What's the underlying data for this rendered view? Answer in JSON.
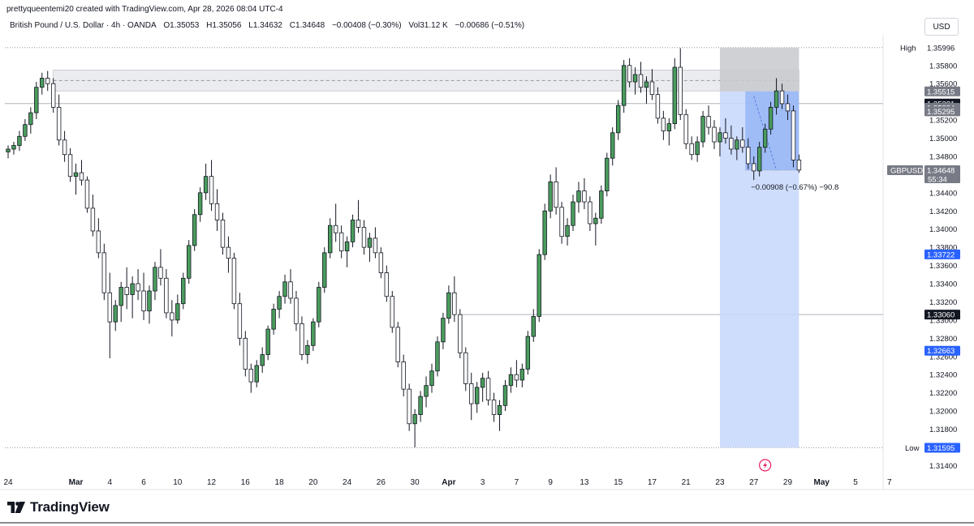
{
  "header": {
    "credit": "prettyqueentemi20 created with TradingView.com, Apr 28, 2026 08:04 UTC-4",
    "currency_button": "USD"
  },
  "legend": {
    "symbol": "British Pound / U.S. Dollar · 4h · OANDA",
    "open": "O1.35053",
    "high": "H1.35056",
    "low": "L1.34632",
    "close": "C1.34648",
    "change": "−0.00408 (−0.30%)",
    "volume": "Vol31.12 K",
    "volume_change": "−0.00686 (−0.51%)"
  },
  "footer": {
    "brand": "TradingView"
  },
  "colors": {
    "up_fill": "#4a9c5d",
    "down_fill": "#ffffff",
    "candle_outline": "#131722",
    "selection_fill": "#c7d7fb",
    "selection_dark": "#8fb0f5",
    "zone_fill": "#d1d4dc",
    "blue_label": "#2962ff",
    "black_label": "#131722",
    "gray_label": "#787b86"
  },
  "chart_data": {
    "type": "candlestick",
    "symbol": "GBPUSD",
    "timeframe": "4h",
    "ylim": [
      1.3135,
      1.3611
    ],
    "y_ticks": [
      1.314,
      1.316,
      1.318,
      1.32,
      1.322,
      1.324,
      1.326,
      1.328,
      1.33,
      1.332,
      1.334,
      1.336,
      1.338,
      1.34,
      1.342,
      1.344,
      1.346,
      1.348,
      1.35,
      1.352,
      1.354,
      1.356,
      1.358
    ],
    "x_ticks": [
      {
        "label": "24",
        "index": 0
      },
      {
        "label": "Mar",
        "index": 12
      },
      {
        "label": "4",
        "index": 18
      },
      {
        "label": "6",
        "index": 24
      },
      {
        "label": "10",
        "index": 30
      },
      {
        "label": "12",
        "index": 36
      },
      {
        "label": "16",
        "index": 42
      },
      {
        "label": "18",
        "index": 48
      },
      {
        "label": "20",
        "index": 54
      },
      {
        "label": "24",
        "index": 60
      },
      {
        "label": "26",
        "index": 66
      },
      {
        "label": "30",
        "index": 72
      },
      {
        "label": "Apr",
        "index": 78
      },
      {
        "label": "3",
        "index": 84
      },
      {
        "label": "7",
        "index": 90
      },
      {
        "label": "9",
        "index": 96
      },
      {
        "label": "13",
        "index": 102
      },
      {
        "label": "15",
        "index": 108
      },
      {
        "label": "17",
        "index": 114
      },
      {
        "label": "21",
        "index": 120
      },
      {
        "label": "23",
        "index": 126
      },
      {
        "label": "27",
        "index": 132
      },
      {
        "label": "29",
        "index": 138
      },
      {
        "label": "May",
        "index": 144
      },
      {
        "label": "5",
        "index": 150
      },
      {
        "label": "7",
        "index": 156
      }
    ],
    "price_labels": [
      {
        "text": "High",
        "value": "1.35996",
        "price": 1.35996,
        "style": "plain"
      },
      {
        "text": "",
        "value": "1.35515",
        "price": 1.35515,
        "style": "gray"
      },
      {
        "text": "",
        "value": "1.35381",
        "price": 1.35381,
        "style": "black"
      },
      {
        "text": "",
        "value": "1.35334",
        "price": 1.35334,
        "style": "gray"
      },
      {
        "text": "",
        "value": "1.35295",
        "price": 1.35295,
        "style": "gray"
      },
      {
        "text": "GBPUSD",
        "value": "1.34648",
        "price": 1.34648,
        "style": "gray",
        "sub": "55:34"
      },
      {
        "text": "",
        "value": "1.33722",
        "price": 1.33722,
        "style": "blue"
      },
      {
        "text": "",
        "value": "1.33060",
        "price": 1.3306,
        "style": "black"
      },
      {
        "text": "",
        "value": "1.32663",
        "price": 1.32663,
        "style": "blue"
      },
      {
        "text": "Low",
        "value": "1.31596",
        "price": 1.31596,
        "style": "plain"
      },
      {
        "text": "",
        "value": "1.31595",
        "price": 1.31595,
        "style": "blue"
      }
    ],
    "high_line": 1.35996,
    "low_line": 1.31596,
    "hline": 1.35381,
    "hline_black": 1.3306,
    "zone": {
      "top": 1.3575,
      "bottom": 1.3552,
      "mid": 1.35634,
      "start_index": 8,
      "end_index": 140
    },
    "projection": {
      "start_index": 126,
      "end_index": 140,
      "top": 1.35996,
      "bottom": 1.31596,
      "entry": 1.35515,
      "current": 1.34648,
      "label": "−0.00908 (−0.67%) −90.8"
    },
    "candles": [
      [
        1.3485,
        1.3492,
        1.3478,
        1.3488
      ],
      [
        1.3488,
        1.3496,
        1.3482,
        1.3492
      ],
      [
        1.3492,
        1.3508,
        1.3486,
        1.3502
      ],
      [
        1.3502,
        1.3521,
        1.3497,
        1.3515
      ],
      [
        1.3515,
        1.3534,
        1.3505,
        1.3528
      ],
      [
        1.3528,
        1.3562,
        1.3521,
        1.3556
      ],
      [
        1.3556,
        1.3572,
        1.3548,
        1.3566
      ],
      [
        1.3566,
        1.3574,
        1.3552,
        1.356
      ],
      [
        1.356,
        1.3566,
        1.3528,
        1.3534
      ],
      [
        1.3534,
        1.3548,
        1.3492,
        1.3498
      ],
      [
        1.3498,
        1.3508,
        1.3474,
        1.3482
      ],
      [
        1.3482,
        1.3489,
        1.3452,
        1.3458
      ],
      [
        1.3458,
        1.3472,
        1.3438,
        1.3462
      ],
      [
        1.3462,
        1.3476,
        1.3448,
        1.3454
      ],
      [
        1.3454,
        1.3458,
        1.3418,
        1.3423
      ],
      [
        1.3423,
        1.3438,
        1.3392,
        1.3398
      ],
      [
        1.3398,
        1.3412,
        1.3368,
        1.3374
      ],
      [
        1.3374,
        1.3384,
        1.3322,
        1.333
      ],
      [
        1.333,
        1.3352,
        1.3258,
        1.3298
      ],
      [
        1.3298,
        1.3322,
        1.3288,
        1.3316
      ],
      [
        1.3316,
        1.3342,
        1.3298,
        1.3336
      ],
      [
        1.3336,
        1.3358,
        1.3312,
        1.3328
      ],
      [
        1.3328,
        1.3348,
        1.3302,
        1.334
      ],
      [
        1.334,
        1.3356,
        1.3322,
        1.3332
      ],
      [
        1.3332,
        1.3352,
        1.33,
        1.331
      ],
      [
        1.331,
        1.3338,
        1.3296,
        1.3332
      ],
      [
        1.3332,
        1.3364,
        1.3322,
        1.3358
      ],
      [
        1.3358,
        1.3378,
        1.3338,
        1.3346
      ],
      [
        1.3346,
        1.3356,
        1.3302,
        1.3308
      ],
      [
        1.3308,
        1.3322,
        1.3282,
        1.33
      ],
      [
        1.33,
        1.3328,
        1.3296,
        1.3318
      ],
      [
        1.3318,
        1.3352,
        1.3312,
        1.3346
      ],
      [
        1.3346,
        1.3388,
        1.334,
        1.3382
      ],
      [
        1.3382,
        1.3422,
        1.3376,
        1.3416
      ],
      [
        1.3416,
        1.3446,
        1.3408,
        1.344
      ],
      [
        1.344,
        1.3472,
        1.3432,
        1.3458
      ],
      [
        1.3458,
        1.3476,
        1.342,
        1.3428
      ],
      [
        1.3428,
        1.3444,
        1.3398,
        1.341
      ],
      [
        1.341,
        1.3418,
        1.3372,
        1.338
      ],
      [
        1.338,
        1.3392,
        1.3352,
        1.3368
      ],
      [
        1.3368,
        1.3374,
        1.3312,
        1.3318
      ],
      [
        1.3318,
        1.333,
        1.3272,
        1.328
      ],
      [
        1.328,
        1.3288,
        1.3238,
        1.3246
      ],
      [
        1.3246,
        1.3252,
        1.322,
        1.3232
      ],
      [
        1.3232,
        1.3256,
        1.3226,
        1.325
      ],
      [
        1.325,
        1.327,
        1.3242,
        1.3262
      ],
      [
        1.3262,
        1.3294,
        1.3256,
        1.329
      ],
      [
        1.329,
        1.3318,
        1.3284,
        1.3312
      ],
      [
        1.3312,
        1.3332,
        1.3302,
        1.3326
      ],
      [
        1.3326,
        1.335,
        1.3318,
        1.3342
      ],
      [
        1.3342,
        1.3356,
        1.3318,
        1.3324
      ],
      [
        1.3324,
        1.3332,
        1.3288,
        1.3296
      ],
      [
        1.3296,
        1.3304,
        1.3256,
        1.3262
      ],
      [
        1.3262,
        1.3278,
        1.3252,
        1.3272
      ],
      [
        1.3272,
        1.3302,
        1.3266,
        1.3298
      ],
      [
        1.3298,
        1.3342,
        1.3292,
        1.3336
      ],
      [
        1.3336,
        1.338,
        1.333,
        1.3374
      ],
      [
        1.3374,
        1.3412,
        1.3368,
        1.3404
      ],
      [
        1.3404,
        1.3428,
        1.3386,
        1.3396
      ],
      [
        1.3396,
        1.3404,
        1.3368,
        1.3376
      ],
      [
        1.3376,
        1.3392,
        1.3358,
        1.3386
      ],
      [
        1.3386,
        1.3416,
        1.338,
        1.341
      ],
      [
        1.341,
        1.3432,
        1.3396,
        1.3402
      ],
      [
        1.3402,
        1.341,
        1.3372,
        1.338
      ],
      [
        1.338,
        1.3396,
        1.3364,
        1.339
      ],
      [
        1.339,
        1.3402,
        1.3368,
        1.3374
      ],
      [
        1.3374,
        1.338,
        1.3346,
        1.3352
      ],
      [
        1.3352,
        1.336,
        1.332,
        1.3326
      ],
      [
        1.3326,
        1.3332,
        1.3286,
        1.3292
      ],
      [
        1.3292,
        1.3298,
        1.3248,
        1.3254
      ],
      [
        1.3254,
        1.3262,
        1.3216,
        1.3224
      ],
      [
        1.3224,
        1.323,
        1.3178,
        1.3186
      ],
      [
        1.3186,
        1.3202,
        1.316,
        1.3196
      ],
      [
        1.3196,
        1.3222,
        1.3188,
        1.3216
      ],
      [
        1.3216,
        1.3238,
        1.3204,
        1.3228
      ],
      [
        1.3228,
        1.3252,
        1.322,
        1.3244
      ],
      [
        1.3244,
        1.3282,
        1.3238,
        1.3276
      ],
      [
        1.3276,
        1.3308,
        1.3268,
        1.3302
      ],
      [
        1.3302,
        1.3338,
        1.3296,
        1.333
      ],
      [
        1.333,
        1.3348,
        1.3298,
        1.3306
      ],
      [
        1.3306,
        1.3312,
        1.3258,
        1.3264
      ],
      [
        1.3264,
        1.327,
        1.3222,
        1.323
      ],
      [
        1.323,
        1.3242,
        1.319,
        1.3208
      ],
      [
        1.3208,
        1.3232,
        1.3198,
        1.3226
      ],
      [
        1.3226,
        1.3242,
        1.321,
        1.3236
      ],
      [
        1.3236,
        1.3244,
        1.3206,
        1.3212
      ],
      [
        1.3212,
        1.322,
        1.3188,
        1.3196
      ],
      [
        1.3196,
        1.3212,
        1.3178,
        1.3206
      ],
      [
        1.3206,
        1.3234,
        1.32,
        1.3228
      ],
      [
        1.3228,
        1.3248,
        1.322,
        1.324
      ],
      [
        1.324,
        1.3256,
        1.3226,
        1.3234
      ],
      [
        1.3234,
        1.3252,
        1.3226,
        1.3246
      ],
      [
        1.3246,
        1.3288,
        1.324,
        1.3282
      ],
      [
        1.3282,
        1.3312,
        1.3276,
        1.3304
      ],
      [
        1.3304,
        1.3378,
        1.3298,
        1.3372
      ],
      [
        1.3372,
        1.3428,
        1.3366,
        1.342
      ],
      [
        1.342,
        1.346,
        1.3412,
        1.3452
      ],
      [
        1.3452,
        1.3468,
        1.3416,
        1.3424
      ],
      [
        1.3424,
        1.343,
        1.3384,
        1.3392
      ],
      [
        1.3392,
        1.3412,
        1.3382,
        1.3404
      ],
      [
        1.3404,
        1.3438,
        1.3398,
        1.343
      ],
      [
        1.343,
        1.3452,
        1.3418,
        1.3442
      ],
      [
        1.3442,
        1.3456,
        1.3422,
        1.343
      ],
      [
        1.343,
        1.3436,
        1.3398,
        1.3406
      ],
      [
        1.3406,
        1.3418,
        1.3382,
        1.3412
      ],
      [
        1.3412,
        1.3448,
        1.3406,
        1.3442
      ],
      [
        1.3442,
        1.3484,
        1.3436,
        1.3478
      ],
      [
        1.3478,
        1.3512,
        1.347,
        1.3506
      ],
      [
        1.3506,
        1.3542,
        1.3498,
        1.3536
      ],
      [
        1.3536,
        1.3586,
        1.3528,
        1.358
      ],
      [
        1.358,
        1.3588,
        1.3556,
        1.3562
      ],
      [
        1.3562,
        1.3578,
        1.3548,
        1.357
      ],
      [
        1.357,
        1.3584,
        1.355,
        1.3556
      ],
      [
        1.3556,
        1.3568,
        1.3538,
        1.3562
      ],
      [
        1.3562,
        1.3576,
        1.3542,
        1.3548
      ],
      [
        1.3548,
        1.3556,
        1.3516,
        1.3522
      ],
      [
        1.3522,
        1.353,
        1.3498,
        1.3508
      ],
      [
        1.3508,
        1.3522,
        1.3492,
        1.3516
      ],
      [
        1.3516,
        1.3588,
        1.351,
        1.3578
      ],
      [
        1.3578,
        1.3599,
        1.352,
        1.3526
      ],
      [
        1.3526,
        1.3532,
        1.3488,
        1.3494
      ],
      [
        1.3494,
        1.3502,
        1.3476,
        1.3482
      ],
      [
        1.3482,
        1.3502,
        1.3474,
        1.3496
      ],
      [
        1.3496,
        1.353,
        1.349,
        1.3524
      ],
      [
        1.3524,
        1.3536,
        1.3504,
        1.3512
      ],
      [
        1.3512,
        1.352,
        1.3488,
        1.3496
      ],
      [
        1.3496,
        1.3512,
        1.348,
        1.3506
      ],
      [
        1.3506,
        1.3522,
        1.3494,
        1.35
      ],
      [
        1.35,
        1.3514,
        1.3482,
        1.3488
      ],
      [
        1.3488,
        1.3502,
        1.3476,
        1.3498
      ],
      [
        1.3498,
        1.3512,
        1.3484,
        1.349
      ],
      [
        1.349,
        1.35,
        1.3466,
        1.3472
      ],
      [
        1.3472,
        1.348,
        1.3454,
        1.3464
      ],
      [
        1.3464,
        1.3496,
        1.3458,
        1.349
      ],
      [
        1.349,
        1.3516,
        1.3484,
        1.351
      ],
      [
        1.351,
        1.354,
        1.3504,
        1.3534
      ],
      [
        1.3534,
        1.3566,
        1.3526,
        1.3552
      ],
      [
        1.3552,
        1.356,
        1.3532,
        1.3538
      ],
      [
        1.3538,
        1.3548,
        1.352,
        1.353
      ],
      [
        1.353,
        1.3536,
        1.3468,
        1.3476
      ],
      [
        1.3476,
        1.3482,
        1.3462,
        1.3465
      ]
    ]
  }
}
